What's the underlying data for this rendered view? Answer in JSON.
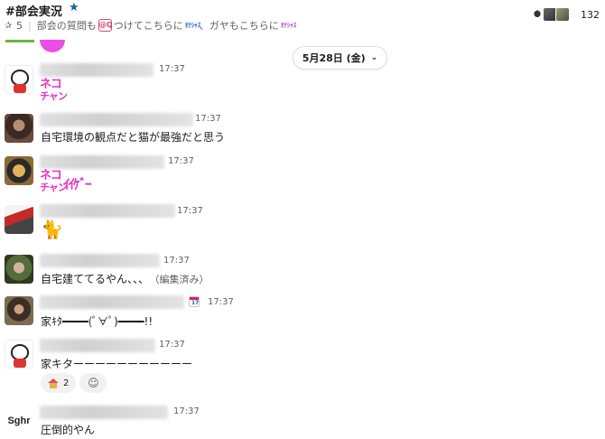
{
  "header": {
    "channel_name": "#部会実況",
    "star_icon": "star-icon",
    "pin_count": "5",
    "topic_part1": "部会の質問も",
    "topic_emoji1": "@Q",
    "topic_part2": "つけてこちらに",
    "topic_emoji2": "ｵﾅｼｬｽ",
    "topic_part3": "、ガヤもこちらに",
    "topic_emoji3": "ｵﾅｼｬｽ",
    "member_count": "132"
  },
  "date_divider": {
    "label": "5月28日 (金)",
    "chevron": "⌄"
  },
  "messages": [
    {
      "time": "17:37",
      "stamp_line1": "ネコ",
      "stamp_line2": "チャン"
    },
    {
      "time": "17:37",
      "text": "自宅環境の観点だと猫が最強だと思う"
    },
    {
      "time": "17:37",
      "stamp_line1": "ネコ",
      "stamp_line2": "チャン",
      "stamp_suffix": "ｲｲｹﾞｰ"
    },
    {
      "time": "17:37",
      "emoji": "🐈"
    },
    {
      "time": "17:37",
      "text": "自宅建ててるやん、、、",
      "edited": "（編集済み）"
    },
    {
      "time": "17:37",
      "text": "家ｷﾀ━━━━(ﾟ∀ﾟ)━━━━!!",
      "calendar_day": "17"
    },
    {
      "time": "17:37",
      "text": "家キターーーーーーーーーーー",
      "reaction_count": "2"
    },
    {
      "time": "17:37",
      "avatar_text": "Sghr",
      "text": "圧倒的やん"
    }
  ]
}
